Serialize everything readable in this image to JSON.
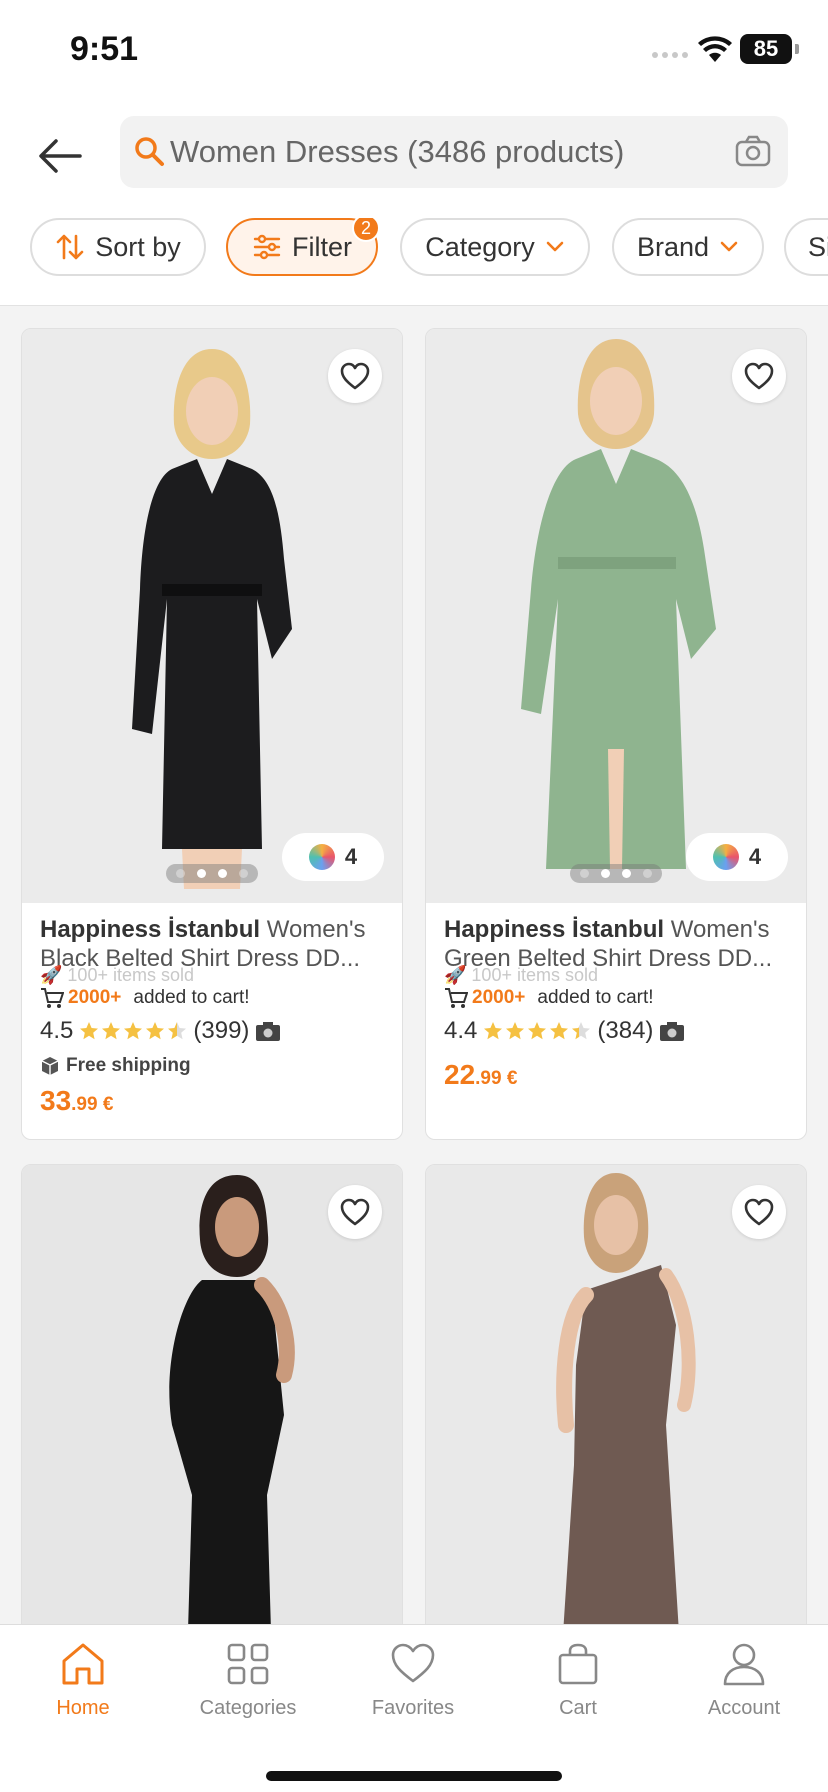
{
  "status_bar": {
    "time": "9:51",
    "battery": "85"
  },
  "header": {
    "search_text": "Women Dresses (3486 products)",
    "chips": [
      {
        "label": "Sort by",
        "icon": "sort-icon"
      },
      {
        "label": "Filter",
        "icon": "filter-icon",
        "badge": "2"
      },
      {
        "label": "Category",
        "icon": "chevron-down-icon"
      },
      {
        "label": "Brand",
        "icon": "chevron-down-icon"
      },
      {
        "label": "Si"
      }
    ]
  },
  "products": [
    {
      "brand": "Happiness İstanbul",
      "name": "Women's Black Belted Shirt Dress DD...",
      "sold": "100+",
      "sold_label": "items sold",
      "cart_count": "2000+",
      "cart_label": "added to cart!",
      "rating": "4.5",
      "reviews": "(399)",
      "shipping": "Free shipping",
      "price_main": "33",
      "price_cents": ".99 €",
      "colors": "4",
      "dress_color": "#1c1c1e"
    },
    {
      "brand": "Happiness İstanbul",
      "name": "Women's Green Belted Shirt Dress DD...",
      "sold": "100+",
      "sold_label": "items sold",
      "cart_count": "2000+",
      "cart_label": "added to cart!",
      "rating": "4.4",
      "reviews": "(384)",
      "price_main": "22",
      "price_cents": ".99 €",
      "colors": "4",
      "dress_color": "#8fb48f"
    },
    {
      "dress_color": "#161616"
    },
    {
      "dress_color": "#6f5a52"
    }
  ],
  "bottom_nav": [
    {
      "label": "Home",
      "icon": "home-icon",
      "active": true
    },
    {
      "label": "Categories",
      "icon": "grid-icon"
    },
    {
      "label": "Favorites",
      "icon": "heart-icon"
    },
    {
      "label": "Cart",
      "icon": "bag-icon"
    },
    {
      "label": "Account",
      "icon": "user-icon"
    }
  ],
  "colors": {
    "accent": "#f27a1a",
    "star": "#f5c142"
  }
}
